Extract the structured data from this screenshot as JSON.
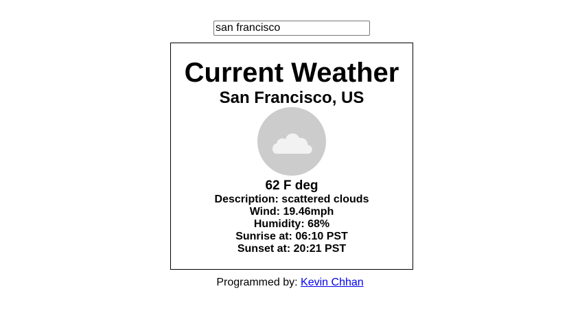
{
  "search": {
    "value": "san francisco"
  },
  "weather": {
    "title": "Current Weather",
    "location": "San Francisco, US",
    "icon": "cloud-icon",
    "temperature": "62 F deg",
    "description": "Description: scattered clouds",
    "wind": "Wind: 19.46mph",
    "humidity": "Humidity: 68%",
    "sunrise": "Sunrise at: 06:10 PST",
    "sunset": "Sunset at: 20:21 PST"
  },
  "footer": {
    "label": "Programmed by:",
    "author_link": "Kevin Chhan"
  },
  "colors": {
    "icon_background": "#cccccc",
    "cloud": "#f2f2f2",
    "link": "#0000ee"
  }
}
